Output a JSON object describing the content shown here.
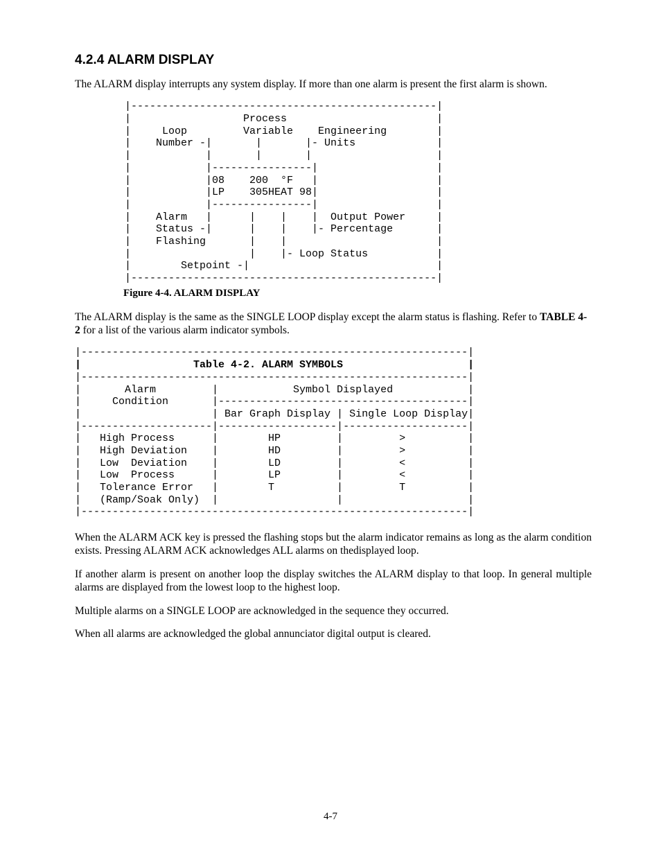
{
  "heading": "4.2.4 ALARM DISPLAY",
  "para1": "The ALARM display interrupts any system display.  If more than one alarm is present the first alarm is shown.",
  "figure": {
    "line01": "        |-------------------------------------------------|",
    "line02": "        |                  Process                        |",
    "line03": "        |     Loop         Variable    Engineering        |",
    "line04": "        |    Number -|       |       |- Units             |",
    "line05": "        |            |       |       |                    |",
    "line06": "        |            |----------------|                   |",
    "line07": "        |            |08    200  °F   |                   |",
    "line08": "        |            |LP    305HEAT 98|                   |",
    "line09": "        |            |----------------|                   |",
    "line10": "        |    Alarm   |      |    |    |  Output Power     |",
    "line11": "        |    Status -|      |    |    |- Percentage       |",
    "line12": "        |    Flashing       |    |                        |",
    "line13": "        |                   |    |- Loop Status           |",
    "line14": "        |        Setpoint -|                              |",
    "line15": "        |-------------------------------------------------|"
  },
  "figcaption": "Figure 4-4.  ALARM DISPLAY",
  "para2a": "The ALARM display is the same as the SINGLE LOOP display except the alarm status is flashing.  Refer to ",
  "para2b": "TABLE 4-2",
  "para2c": " for a list of the various alarm indicator symbols.",
  "table": {
    "t01": "|--------------------------------------------------------------|",
    "t02": "|                  Table 4-2. ALARM SYMBOLS                    |",
    "t03": "|--------------------------------------------------------------|",
    "t04": "|       Alarm         |            Symbol Displayed            |",
    "t05": "|     Condition       |----------------------------------------|",
    "t06": "|                     | Bar Graph Display | Single Loop Display|",
    "t07": "|---------------------|-------------------|--------------------|",
    "t08": "|   High Process      |        HP         |         >          |",
    "t09": "|   High Deviation    |        HD         |         >          |",
    "t10": "|   Low  Deviation    |        LD         |         <          |",
    "t11": "|   Low  Process      |        LP         |         <          |",
    "t12": "|   Tolerance Error   |        T          |         T          |",
    "t13": "|   (Ramp/Soak Only)  |                   |                    |",
    "t14": "|--------------------------------------------------------------|"
  },
  "para3": "When the ALARM ACK key is pressed the flashing stops but the alarm indicator remains as long as the alarm condition exists. Pressing ALARM ACK acknowledges ALL alarms on thedisplayed loop.",
  "para4": "If another alarm is present on another loop the display switches the ALARM display to that loop.  In general multiple alarms are displayed from the lowest loop to the highest loop.",
  "para5": "Multiple alarms on a SINGLE LOOP are acknowledged in the sequence they occurred.",
  "para6": "When all alarms are acknowledged the global annunciator digital output is cleared.",
  "pageNumber": "4-7"
}
